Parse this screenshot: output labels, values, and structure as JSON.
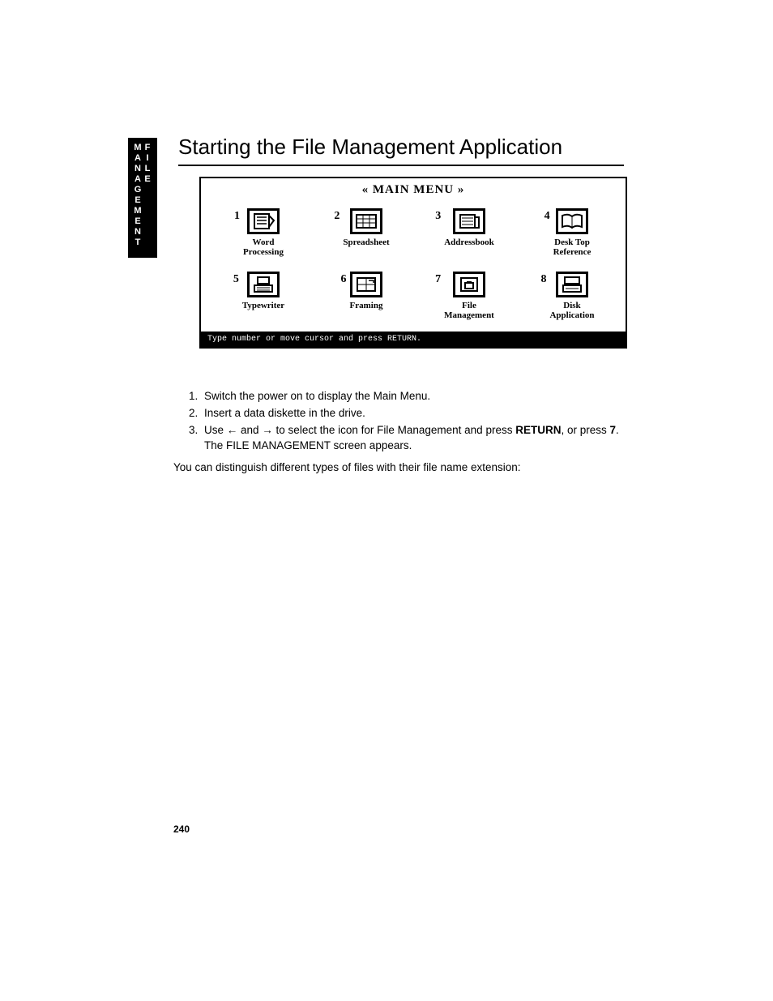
{
  "sidebar_label": "FILE MANAGEMENT",
  "title": "Starting the File Management Application",
  "menu": {
    "header": "« MAIN MENU »",
    "items": [
      {
        "num": "1",
        "label": "Word\nProcessing"
      },
      {
        "num": "2",
        "label": "Spreadsheet"
      },
      {
        "num": "3",
        "label": "Addressbook"
      },
      {
        "num": "4",
        "label": "Desk Top\nReference"
      },
      {
        "num": "5",
        "label": "Typewriter"
      },
      {
        "num": "6",
        "label": "Framing"
      },
      {
        "num": "7",
        "label": "File\nManagement"
      },
      {
        "num": "8",
        "label": "Disk\nApplication"
      }
    ],
    "prompt": "Type number or move cursor and press RETURN."
  },
  "steps": {
    "s1": "Switch the power on to display the Main Menu.",
    "s2": "Insert a data diskette in the drive.",
    "s3_a": "Use ",
    "s3_l": "←",
    "s3_b": " and ",
    "s3_r": "→",
    "s3_c": " to select the icon for File Management and press ",
    "s3_return": "RETURN",
    "s3_d": ", or press ",
    "s3_seven": "7",
    "s3_e": ". The FILE MANAGEMENT screen appears."
  },
  "note": "You can distinguish different types of files with their file name extension:",
  "page_number": "240"
}
